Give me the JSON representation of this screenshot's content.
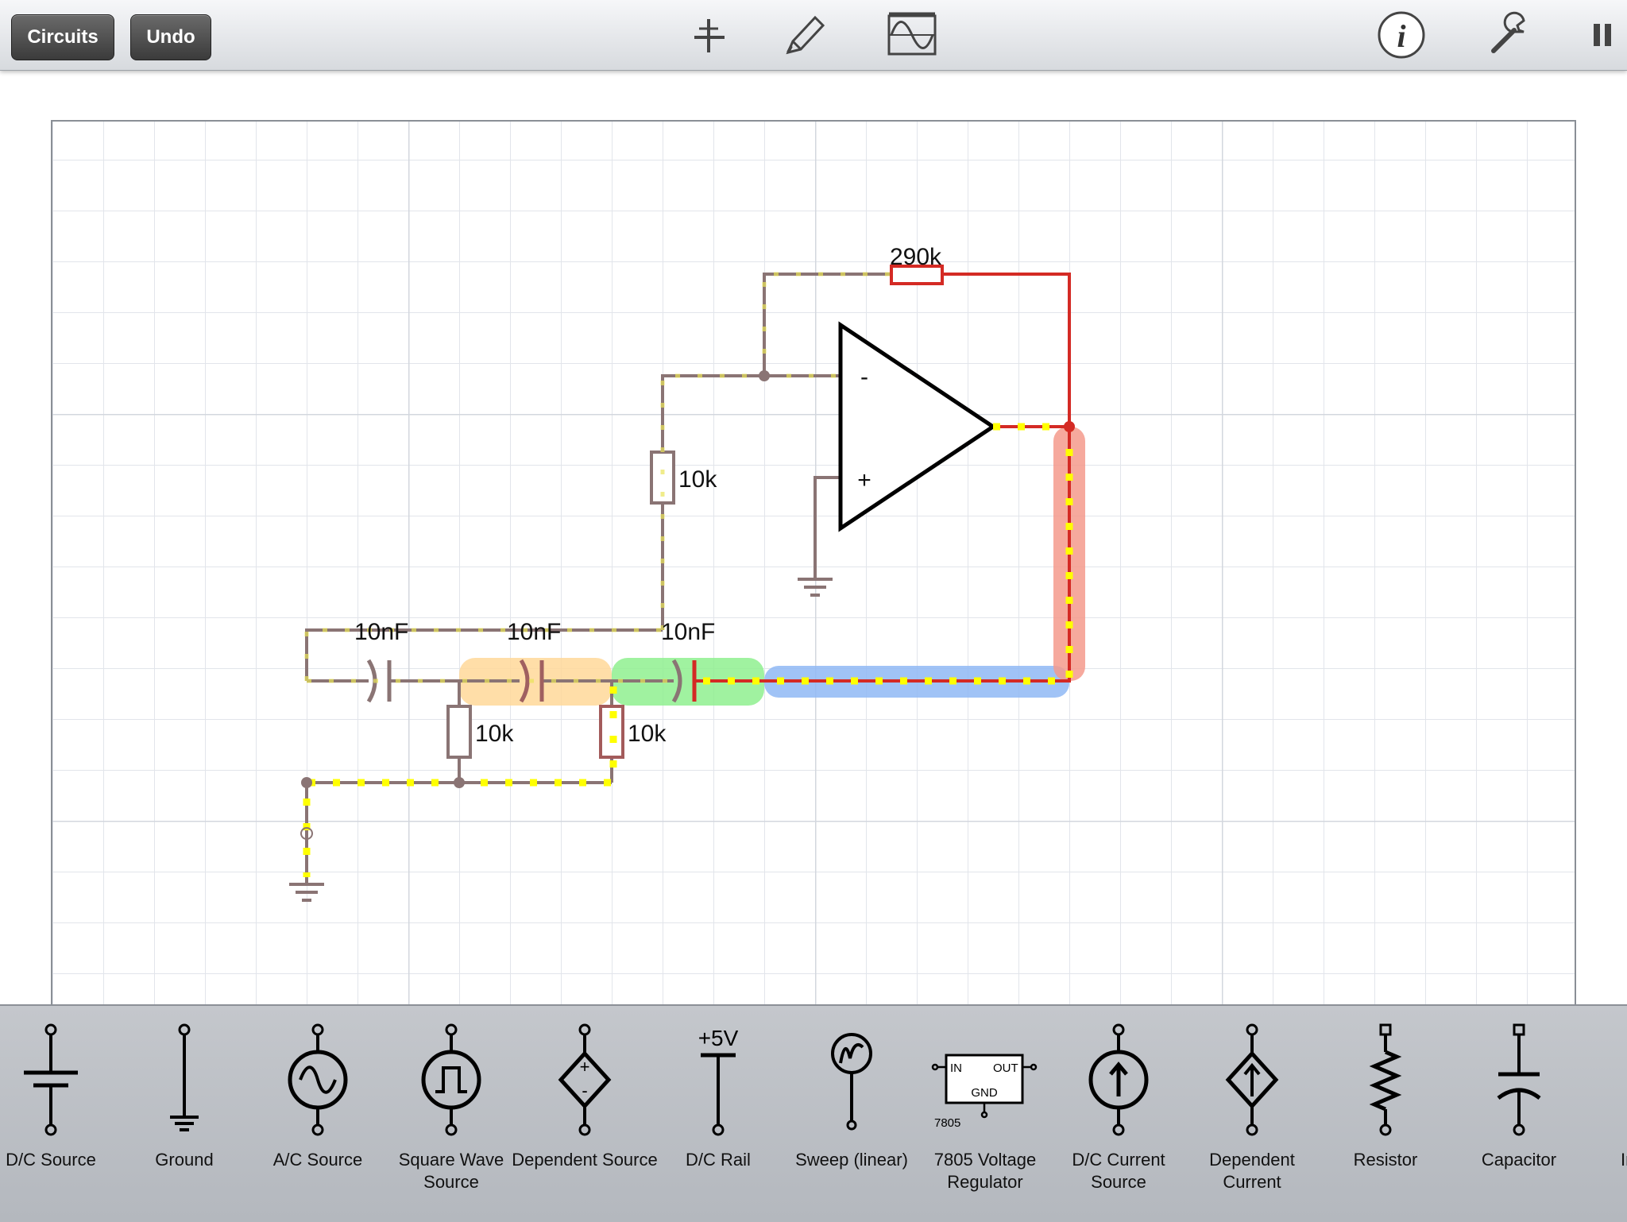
{
  "toolbar": {
    "circuits_label": "Circuits",
    "undo_label": "Undo",
    "icons": [
      "add-icon",
      "pencil-icon",
      "oscilloscope-icon",
      "info-icon",
      "wrench-icon",
      "pause-icon"
    ]
  },
  "circuit": {
    "labels": {
      "r_feedback": "290k",
      "r_input": "10k",
      "c3": "10nF",
      "c2": "10nF",
      "c1": "10nF",
      "r_shunt1": "10k",
      "r_shunt2": "10k",
      "opamp_minus": "-",
      "opamp_plus": "+"
    },
    "colors": {
      "wire": "#8a7474",
      "active_wire": "#d42a24",
      "current_dots": "#ffff00",
      "highlight_orange": "#ffd899",
      "highlight_green": "#8ff08f",
      "highlight_blue": "#8fb8f5",
      "highlight_red": "#f49a8c"
    }
  },
  "palette": {
    "items": [
      {
        "label": "D/C Source",
        "icon": "dc-source-icon"
      },
      {
        "label": "Ground",
        "icon": "ground-icon"
      },
      {
        "label": "A/C Source",
        "icon": "ac-source-icon"
      },
      {
        "label": "Square Wave Source",
        "icon": "square-wave-source-icon"
      },
      {
        "label": "Dependent Source",
        "icon": "dependent-source-icon"
      },
      {
        "label": "D/C Rail",
        "icon": "dc-rail-icon",
        "value": "+5V"
      },
      {
        "label": "Sweep (linear)",
        "icon": "sweep-icon"
      },
      {
        "label": "7805 Voltage Regulator",
        "icon": "voltage-regulator-icon",
        "pins": {
          "in": "IN",
          "out": "OUT",
          "gnd": "GND",
          "part": "7805"
        }
      },
      {
        "label": "D/C Current Source",
        "icon": "dc-current-source-icon"
      },
      {
        "label": "Dependent Current",
        "icon": "dependent-current-icon"
      },
      {
        "label": "Resistor",
        "icon": "resistor-icon"
      },
      {
        "label": "Capacitor",
        "icon": "capacitor-icon"
      },
      {
        "label": "In",
        "icon": "inductor-icon"
      }
    ]
  }
}
